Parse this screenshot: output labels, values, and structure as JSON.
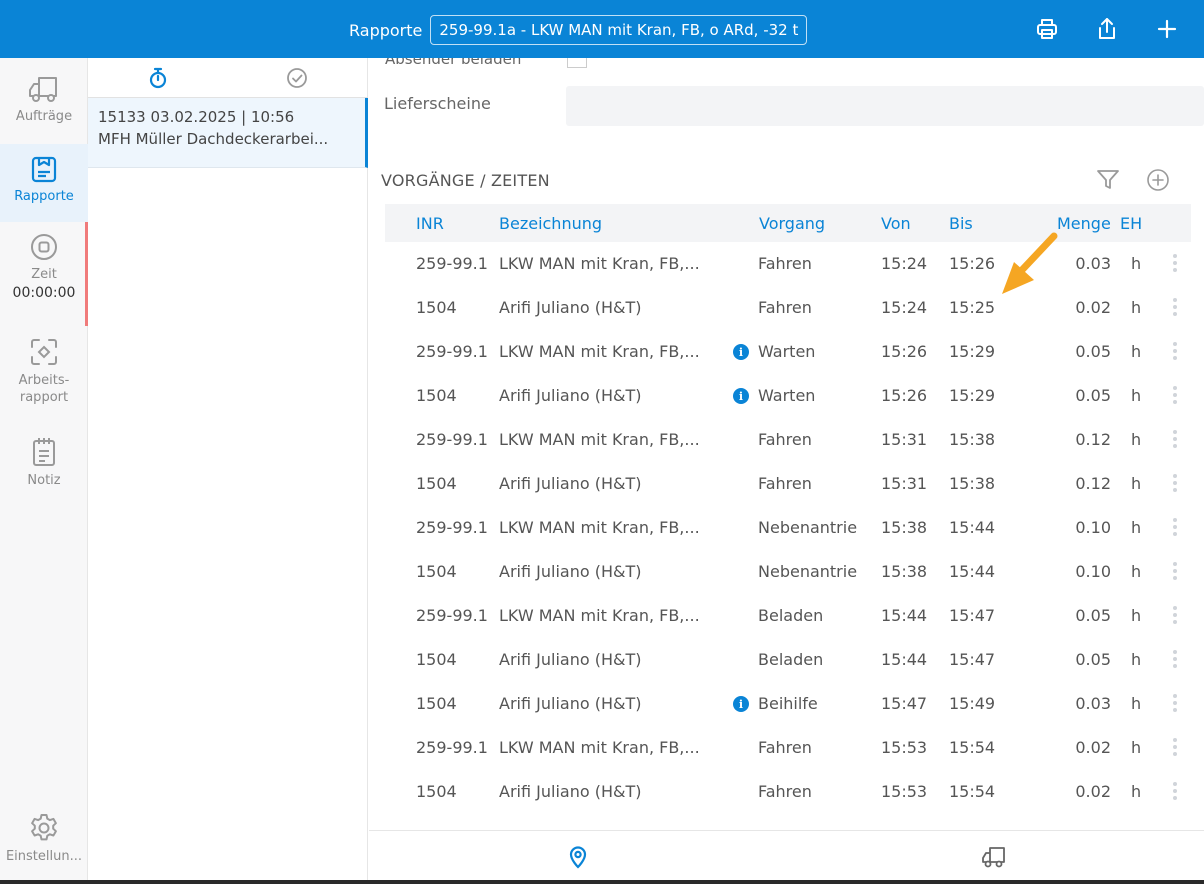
{
  "header": {
    "title": "Rapporte",
    "selector": "259-99.1a - LKW MAN mit Kran, FB, o ARd, -32 t",
    "icons": [
      "printer-icon",
      "share-icon",
      "plus-icon"
    ]
  },
  "nav": {
    "items": [
      {
        "label": "Aufträge",
        "icon": "truck-icon"
      },
      {
        "label": "Rapporte",
        "icon": "clipboard-icon"
      },
      {
        "label": "Zeit",
        "icon": "stop-circle-icon"
      },
      {
        "label": "Arbeits-\nrapport",
        "icon": "scan-icon"
      },
      {
        "label": "Notiz",
        "icon": "notepad-icon"
      },
      {
        "label": "Einstellun...",
        "icon": "gear-icon"
      }
    ],
    "timer": "00:00:00"
  },
  "list": {
    "tabs": [
      "stopwatch-icon",
      "check-circle-icon"
    ],
    "card": {
      "line1": "15133 03.02.2025 | 10:56",
      "line2": "MFH Müller Dachdeckerarbei..."
    }
  },
  "detail": {
    "cut_label": "Absender beladen",
    "delivery_label": "Lieferscheine",
    "section_title": "VORGÄNGE / ZEITEN",
    "columns": {
      "inr": "INR",
      "bez": "Bezeichnung",
      "vorgang": "Vorgang",
      "von": "Von",
      "bis": "Bis",
      "menge": "Menge",
      "eh": "EH"
    },
    "rows": [
      {
        "inr": "259-99.1",
        "bez": "LKW MAN mit Kran, FB,...",
        "info": false,
        "vorgang": "Fahren",
        "von": "15:24",
        "bis": "15:26",
        "menge": "0.03",
        "eh": "h"
      },
      {
        "inr": "1504",
        "bez": "Arifi Juliano (H&T)",
        "info": false,
        "vorgang": "Fahren",
        "von": "15:24",
        "bis": "15:25",
        "menge": "0.02",
        "eh": "h"
      },
      {
        "inr": "259-99.1",
        "bez": "LKW MAN mit Kran, FB,...",
        "info": true,
        "vorgang": "Warten",
        "von": "15:26",
        "bis": "15:29",
        "menge": "0.05",
        "eh": "h"
      },
      {
        "inr": "1504",
        "bez": "Arifi Juliano (H&T)",
        "info": true,
        "vorgang": "Warten",
        "von": "15:26",
        "bis": "15:29",
        "menge": "0.05",
        "eh": "h"
      },
      {
        "inr": "259-99.1",
        "bez": "LKW MAN mit Kran, FB,...",
        "info": false,
        "vorgang": "Fahren",
        "von": "15:31",
        "bis": "15:38",
        "menge": "0.12",
        "eh": "h"
      },
      {
        "inr": "1504",
        "bez": "Arifi Juliano (H&T)",
        "info": false,
        "vorgang": "Fahren",
        "von": "15:31",
        "bis": "15:38",
        "menge": "0.12",
        "eh": "h"
      },
      {
        "inr": "259-99.1",
        "bez": "LKW MAN mit Kran, FB,...",
        "info": false,
        "vorgang": "Nebenantrie",
        "von": "15:38",
        "bis": "15:44",
        "menge": "0.10",
        "eh": "h"
      },
      {
        "inr": "1504",
        "bez": "Arifi Juliano (H&T)",
        "info": false,
        "vorgang": "Nebenantrie",
        "von": "15:38",
        "bis": "15:44",
        "menge": "0.10",
        "eh": "h"
      },
      {
        "inr": "259-99.1",
        "bez": "LKW MAN mit Kran, FB,...",
        "info": false,
        "vorgang": "Beladen",
        "von": "15:44",
        "bis": "15:47",
        "menge": "0.05",
        "eh": "h"
      },
      {
        "inr": "1504",
        "bez": "Arifi Juliano (H&T)",
        "info": false,
        "vorgang": "Beladen",
        "von": "15:44",
        "bis": "15:47",
        "menge": "0.05",
        "eh": "h"
      },
      {
        "inr": "1504",
        "bez": "Arifi Juliano (H&T)",
        "info": true,
        "vorgang": "Beihilfe",
        "von": "15:47",
        "bis": "15:49",
        "menge": "0.03",
        "eh": "h"
      },
      {
        "inr": "259-99.1",
        "bez": "LKW MAN mit Kran, FB,...",
        "info": false,
        "vorgang": "Fahren",
        "von": "15:53",
        "bis": "15:54",
        "menge": "0.02",
        "eh": "h"
      },
      {
        "inr": "1504",
        "bez": "Arifi Juliano (H&T)",
        "info": false,
        "vorgang": "Fahren",
        "von": "15:53",
        "bis": "15:54",
        "menge": "0.02",
        "eh": "h"
      }
    ]
  },
  "bottom": {
    "icons": [
      "location-pin-icon",
      "truck-icon"
    ]
  },
  "colors": {
    "accent": "#0a84d6",
    "annotation_arrow": "#f5a623",
    "timer_bar": "#f07b7b"
  }
}
